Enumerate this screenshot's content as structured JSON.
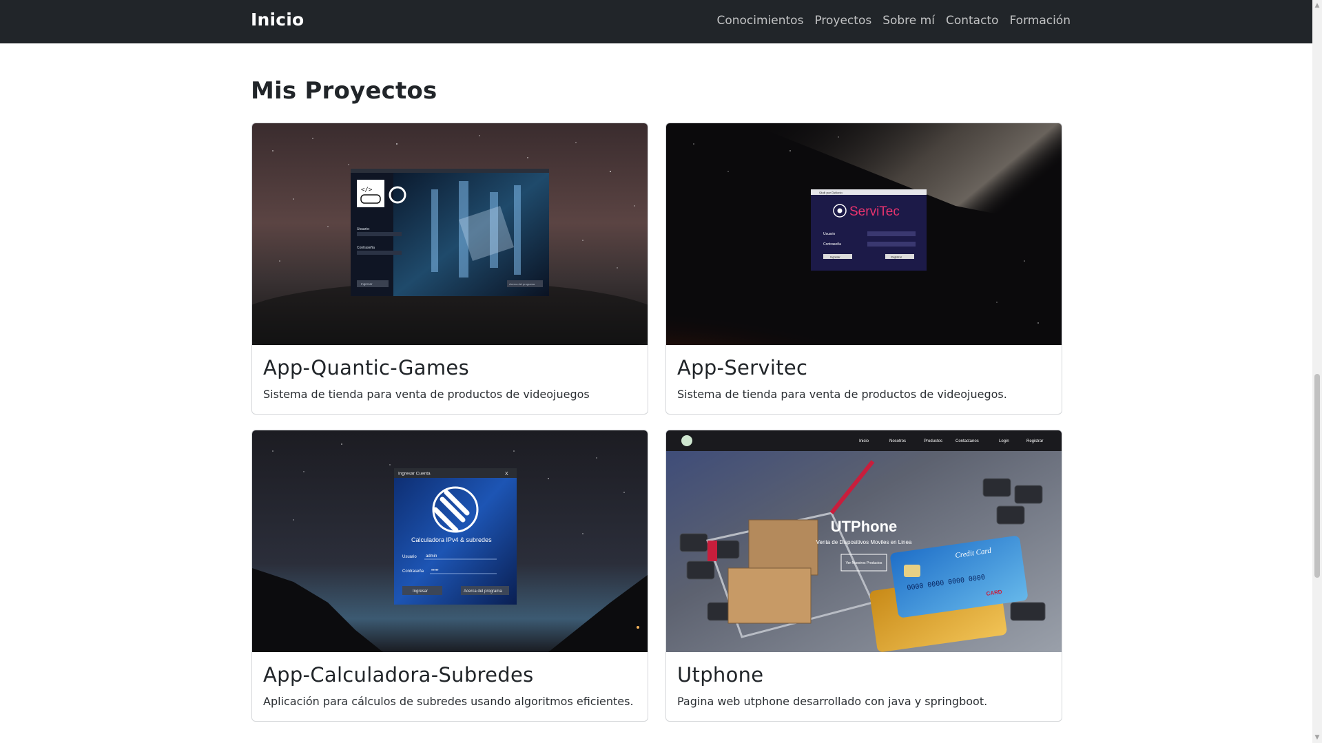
{
  "nav": {
    "brand": "Inicio",
    "links": [
      "Conocimientos",
      "Proyectos",
      "Sobre mí",
      "Contacto",
      "Formación"
    ]
  },
  "section": {
    "title": "Mis Proyectos"
  },
  "projects": [
    {
      "title": "App-Quantic-Games",
      "description": "Sistema de tienda para venta de productos de videojuegos",
      "screen": {
        "user_label": "Usuario:",
        "pass_label": "Contraseña",
        "login_button": "Ingresar",
        "about_button": "Acerca del programa"
      }
    },
    {
      "title": "App-Servitec",
      "description": "Sistema de tienda para venta de productos de videojuegos.",
      "screen": {
        "window_title": "Stub por Defecto",
        "logo_text": "ServiTec",
        "user_label": "Usuario",
        "pass_label": "Contraseña",
        "login_button": "Ingresar",
        "register_button": "Registrar"
      }
    },
    {
      "title": "App-Calculadora-Subredes",
      "description": "Aplicación para cálculos de subredes usando algoritmos eficientes.",
      "screen": {
        "window_title": "Ingresar Cuenta",
        "app_name": "Calculadora IPv4 & subredes",
        "user_label": "Usuario",
        "user_value": "admin",
        "pass_label": "Contraseña",
        "pass_value": "•••••",
        "login_button": "Ingresar",
        "about_button": "Acerca del programa"
      }
    },
    {
      "title": "Utphone",
      "description": "Pagina web utphone desarrollado con java y springboot.",
      "screen": {
        "nav": [
          "Inicio",
          "Nosotros",
          "Productos",
          "Contactanos",
          "Login",
          "Registrar"
        ],
        "hero_title": "UTPhone",
        "hero_subtitle": "Venta de Dispositivos Moviles en Linea",
        "hero_button": "Ver Nuestros Productos",
        "card_label": "Credit Card",
        "card_number": "0000 0000 0000 0000",
        "card_brand": "CARD"
      }
    }
  ],
  "colors": {
    "navbar": "#212529",
    "accent_red": "#c81e3c",
    "mars": "#a1421f"
  }
}
